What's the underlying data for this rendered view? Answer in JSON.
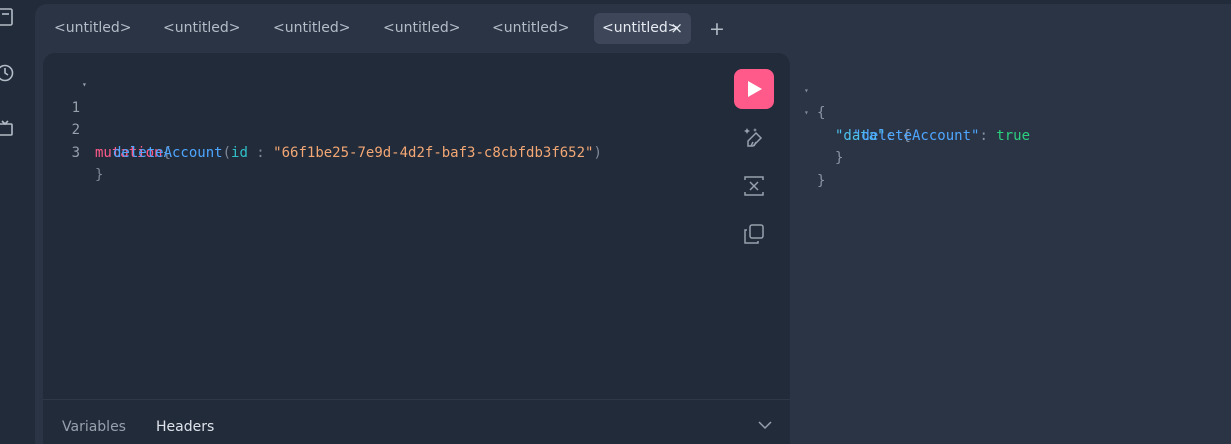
{
  "tabs": [
    {
      "label": "<untitled>",
      "active": false
    },
    {
      "label": "<untitled>",
      "active": false
    },
    {
      "label": "<untitled>",
      "active": false
    },
    {
      "label": "<untitled>",
      "active": false
    },
    {
      "label": "<untitled>",
      "active": false
    },
    {
      "label": "<untitled>",
      "active": true,
      "close_label": "×"
    }
  ],
  "add_tab_label": "+",
  "editor": {
    "line_numbers": [
      "1",
      "2",
      "3"
    ],
    "fold_glyph": "▾",
    "line1": {
      "keyword": "mutation",
      "brace": "{"
    },
    "line2": {
      "field": "deleteAccount",
      "open": "(",
      "arg": "id",
      "colon": " : ",
      "value": "\"66f1be25-7e9d-4d2f-baf3-c8cbfdb3f652\"",
      "close": ")"
    },
    "line3": {
      "brace": "}"
    }
  },
  "editor_footer": {
    "variables_label": "Variables",
    "headers_label": "Headers"
  },
  "result": {
    "fold_glyph": "▾",
    "open_brace": "{",
    "data_key": "\"data\"",
    "colon": ": ",
    "inner_open": "{",
    "field_key": "\"deleteAccount\"",
    "field_value": "true",
    "inner_close": "}",
    "close_brace": "}"
  },
  "colors": {
    "run_button": "#ff5a8a",
    "keyword": "#ff5a8a",
    "field": "#4ea6ff",
    "argument": "#2fc1c8",
    "string": "#f2a774",
    "boolean": "#2bd07f"
  },
  "icons": [
    "docs-icon",
    "history-icon",
    "explorer-icon",
    "play-icon",
    "prettify-icon",
    "merge-fragments-icon",
    "copy-icon",
    "chevron-down-icon"
  ]
}
